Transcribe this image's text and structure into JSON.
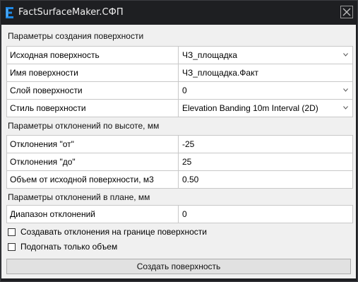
{
  "window": {
    "title": "FactSurfaceMaker.СФП",
    "close_label": "close"
  },
  "sections": {
    "creation": "Параметры создания поверхности",
    "height": "Параметры отклонений по высоте, мм",
    "plan": "Параметры отклонений в плане, мм"
  },
  "creation_rows": [
    {
      "label": "Исходная поверхность",
      "value": "ЧЗ_площадка",
      "dropdown": true
    },
    {
      "label": "Имя поверхности",
      "value": "ЧЗ_площадка.Факт",
      "dropdown": false
    },
    {
      "label": "Слой поверхности",
      "value": "0",
      "dropdown": true
    },
    {
      "label": "Стиль поверхности",
      "value": "Elevation Banding 10m Interval (2D)",
      "dropdown": true
    }
  ],
  "height_rows": [
    {
      "label": "Отклонения \"от\"",
      "value": "-25"
    },
    {
      "label": "Отклонения \"до\"",
      "value": "25"
    },
    {
      "label": "Объем от исходной поверхности, м3",
      "value": "0.50"
    }
  ],
  "plan_rows": [
    {
      "label": "Диапазон отклонений",
      "value": "0"
    }
  ],
  "options": [
    {
      "label": "Создавать отклонения на границе поверхности",
      "checked": false
    },
    {
      "label": "Подогнать только объем",
      "checked": false
    }
  ],
  "actions": {
    "create_label": "Создать поверхность"
  },
  "colors": {
    "titlebar": "#1e1f22",
    "client": "#f0f0f0",
    "icon_accent": "#1e88e5"
  },
  "icons": {
    "app": "app-logo-icon",
    "close": "close-icon",
    "dropdown": "chevron-down-icon"
  }
}
